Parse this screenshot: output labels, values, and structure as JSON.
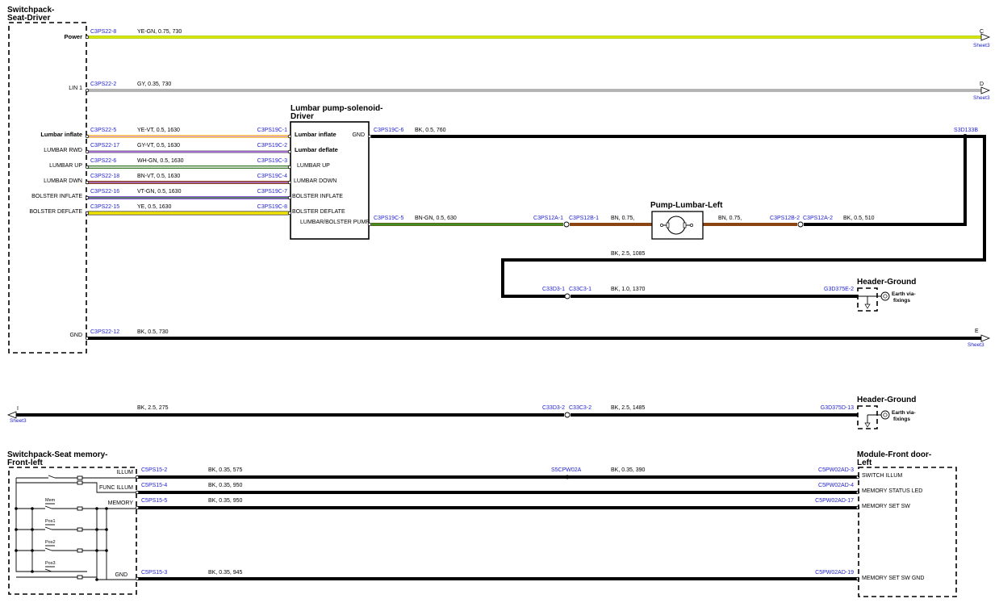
{
  "components": {
    "switchpack_driver": {
      "title_l1": "Switchpack-",
      "title_l2": "Seat-Driver"
    },
    "lumbar_module": {
      "title_l1": "Lumbar pump-solenoid-",
      "title_l2": "Driver"
    },
    "pump": {
      "title": "Pump-Lumbar-Left"
    },
    "header_ground_1": {
      "title": "Header-Ground",
      "earth_l1": "Earth via-",
      "earth_l2": "fixings"
    },
    "header_ground_2": {
      "title": "Header-Ground",
      "earth_l1": "Earth via-",
      "earth_l2": "fixings"
    },
    "switchpack_memory": {
      "title_l1": "Switchpack-Seat memory-",
      "title_l2": "Front-left"
    },
    "front_door": {
      "title_l1": "Module-Front door-",
      "title_l2": "Left"
    }
  },
  "switchpack_pins": [
    {
      "label": "Power"
    },
    {
      "label": "LIN 1"
    },
    {
      "label": "Lumbar inflate"
    },
    {
      "label": "LUMBAR RWD"
    },
    {
      "label": "LUMBAR UP"
    },
    {
      "label": "LUMBAR DWN"
    },
    {
      "label": "BOLSTER INFLATE"
    },
    {
      "label": "BOLSTER DEFLATE"
    },
    {
      "label": "GND"
    }
  ],
  "lumbar_pins": [
    {
      "label": "Lumbar inflate"
    },
    {
      "label": "Lumbar deflate"
    },
    {
      "label": "LUMBAR UP"
    },
    {
      "label": "LUMBAR DOWN"
    },
    {
      "label": "BOLSTER INFLATE"
    },
    {
      "label": "BOLSTER DEFLATE"
    },
    {
      "label": "LUMBAR/BOLSTER PUMP"
    },
    {
      "label": "GND"
    }
  ],
  "wires": [
    {
      "from": "C3PS22-8",
      "spec": "YE-GN,  0.75,  730",
      "to_sheet": "C",
      "sheet": "Sheet3",
      "color": "#c8e61e",
      "stripe": "#e6e600"
    },
    {
      "from": "C3PS22-2",
      "spec": "GY,  0.35,  730",
      "to_sheet": "D",
      "sheet": "Sheet3",
      "color": "#b4b4b4"
    },
    {
      "from": "C3PS22-5",
      "spec": "YE-VT,  0.5,  1630",
      "to": "C3PS19C-1",
      "color": "#ffe24a",
      "stripe": "#c77ad6"
    },
    {
      "from": "C3PS22-17",
      "spec": "GY-VT,  0.5,  1630",
      "to": "C3PS19C-2",
      "color": "#b4b4b4",
      "stripe": "#9b55d6"
    },
    {
      "from": "C3PS22-6",
      "spec": "WH-GN,  0.5,  1630",
      "to": "C3PS19C-3",
      "color": "#e8e8e8",
      "stripe": "#3a9a28"
    },
    {
      "from": "C3PS22-18",
      "spec": "BN-VT,  0.5,  1630",
      "to": "C3PS19C-4",
      "color": "#8b4513",
      "stripe": "#9b55d6"
    },
    {
      "from": "C3PS22-16",
      "spec": "VT-GN,  0.5,  1630",
      "to": "C3PS19C-7",
      "color": "#8a5ad6",
      "stripe": "#3a9a28"
    },
    {
      "from": "C3PS22-15",
      "spec": "YE,  0.5,  1630",
      "to": "C3PS19C-8",
      "color": "#f5e600"
    },
    {
      "from": "C3PS22-12",
      "spec": "BK,  0.5,  730",
      "to_sheet": "E",
      "sheet": "Sheet3",
      "color": "#000000"
    },
    {
      "from": "C3PS19C-6",
      "spec": "BK,  0.5,  760",
      "to": "S3D133B",
      "color": "#000000"
    },
    {
      "from": "C3PS19C-5",
      "spec": "BN-GN,  0.5,  630",
      "to": "C3PS12A-1",
      "color": "#7a5a10",
      "stripe": "#3a9a28"
    },
    {
      "from": "C3PS12B-1",
      "spec": "BN,  0.75,",
      "to": "pump",
      "color": "#8b4513"
    },
    {
      "from": "pump",
      "spec": "BN,  0.75,",
      "to": "C3PS12B-2",
      "color": "#8b4513"
    },
    {
      "from": "C3PS12A-2",
      "spec": "BK,  0.5,  510",
      "color": "#000000"
    },
    {
      "from": "S3D133B",
      "spec": "BK,  2.5,  1085",
      "color": "#000000"
    },
    {
      "from": "C33D3-1",
      "spec": "BK,  1.0,  1370",
      "to": "G3D375E-2",
      "extra": "C33C3-1",
      "color": "#000000"
    },
    {
      "from": "I",
      "sheet": "Sheet3",
      "spec": "BK,  2.5,  275",
      "to": "C33D3-2",
      "color": "#000000"
    },
    {
      "from": "C33C3-2",
      "spec": "BK,  2.5,  1485",
      "to": "G3D375D-13",
      "color": "#000000"
    },
    {
      "from": "C5PS15-2",
      "spec": "BK,  0.35,  575",
      "to": "S5CPW02A",
      "color": "#000000"
    },
    {
      "from": "S5CPW02A",
      "spec": "BK,  0.35,  390",
      "to": "C5PW02AD-3",
      "color": "#000000"
    },
    {
      "from": "C5PS15-4",
      "spec": "BK,  0.35,  950",
      "to": "C5PW02AD-4",
      "color": "#000000"
    },
    {
      "from": "C5PS15-5",
      "spec": "BK,  0.35,  950",
      "to": "C5PW02AD-17",
      "color": "#000000"
    },
    {
      "from": "C5PS15-3",
      "spec": "BK,  0.35,  945",
      "to": "C5PW02AD-19",
      "color": "#000000"
    }
  ],
  "memory_pins": [
    {
      "label": "ILLUM"
    },
    {
      "label": "FUNC ILLUM"
    },
    {
      "label": "MEMORY"
    },
    {
      "label": "GND"
    }
  ],
  "memory_switches": [
    {
      "label": "Mem"
    },
    {
      "label": "Pos1"
    },
    {
      "label": "Pos2"
    },
    {
      "label": "Pos3"
    }
  ],
  "door_pins": [
    {
      "label": "SWITCH ILLUM"
    },
    {
      "label": "MEMORY STATUS LED"
    },
    {
      "label": "MEMORY SET SW"
    },
    {
      "label": "MEMORY SET SW GND"
    }
  ]
}
